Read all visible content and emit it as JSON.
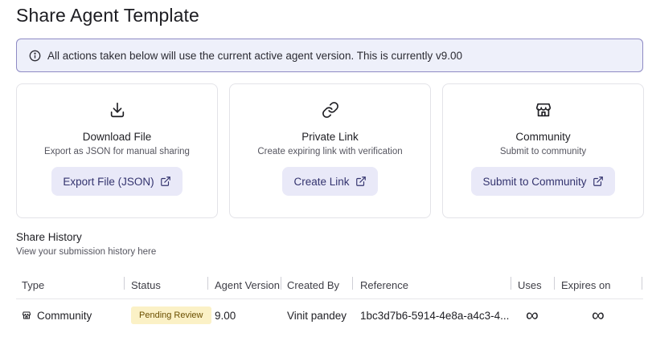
{
  "page": {
    "title": "Share Agent Template"
  },
  "banner": {
    "icon": "info-icon",
    "text": "All actions taken below will use the current active agent version. This is currently v9.00"
  },
  "cards": [
    {
      "icon": "download-icon",
      "title": "Download File",
      "description": "Export as JSON for manual sharing",
      "button": "Export File (JSON)"
    },
    {
      "icon": "link-icon",
      "title": "Private Link",
      "description": "Create expiring link with verification",
      "button": "Create Link"
    },
    {
      "icon": "store-icon",
      "title": "Community",
      "description": "Submit to community",
      "button": "Submit to Community"
    }
  ],
  "history": {
    "title": "Share History",
    "subtitle": "View your submission history here",
    "columns": [
      "Type",
      "Status",
      "Agent Version",
      "Created By",
      "Reference",
      "Uses",
      "Expires on"
    ],
    "rows": [
      {
        "type": "Community",
        "type_icon": "store-icon",
        "status": "Pending Review",
        "agent_version": "9.00",
        "created_by": "Vinit pandey",
        "reference": "1bc3d7b6-5914-4e8a-a4c3-4...",
        "uses": "∞",
        "expires_on": "∞"
      }
    ]
  },
  "colors": {
    "accent_bg": "#e9e9f8",
    "accent_text": "#33336e",
    "banner_border": "#8e8ac4",
    "badge_bg": "#fbf1c6"
  }
}
